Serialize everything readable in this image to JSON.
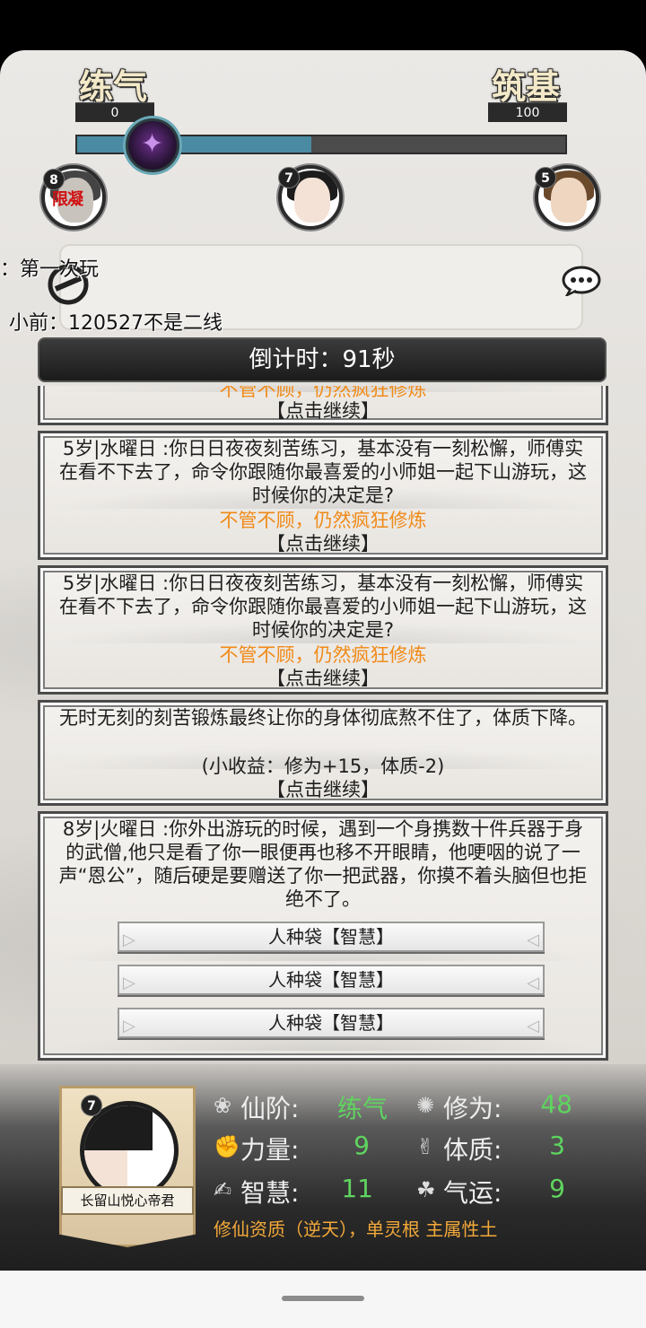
{
  "realm": {
    "current": {
      "name": "练气",
      "value": "0"
    },
    "next": {
      "name": "筑基",
      "value": "100"
    },
    "progress": 0.48
  },
  "opponents": [
    {
      "badge": "8",
      "tag": "限凝"
    },
    {
      "badge": "7",
      "tag": ""
    },
    {
      "badge": "5",
      "tag": ""
    }
  ],
  "chat": {
    "line1": "：第一次玩",
    "line2": "小前：120527不是二线"
  },
  "timer": {
    "text": "倒计时：91秒"
  },
  "feed": {
    "top_choice": "不管不顾，仍然疯狂修炼",
    "top_continue": "【点击继续】",
    "cards": [
      {
        "text": "5岁|水曜日 :你日日夜夜刻苦练习，基本没有一刻松懈，师傅实在看不下去了，命令你跟随你最喜爱的小师姐一起下山游玩，这时候你的决定是?",
        "choice": "不管不顾，仍然疯狂修炼",
        "continue": "【点击继续】"
      },
      {
        "text": "5岁|水曜日 :你日日夜夜刻苦练习，基本没有一刻松懈，师傅实在看不下去了，命令你跟随你最喜爱的小师姐一起下山游玩，这时候你的决定是?",
        "choice": "不管不顾，仍然疯狂修炼",
        "continue": "【点击继续】"
      },
      {
        "text": "无时无刻的刻苦锻炼最终让你的身体彻底熬不住了，体质下降。",
        "gain": "(小收益：修为+15，体质-2)",
        "continue": "【点击继续】"
      }
    ],
    "event": {
      "text": "8岁|火曜日 :你外出游玩的时候，遇到一个身携数十件兵器于身的武僧,他只是看了你一眼便再也移不开眼睛，他哽咽的说了一声“恩公”，随后硬是要赠送了你一把武器，你摸不着头脑但也拒绝不了。",
      "options": [
        "人种袋【智慧】",
        "人种袋【智慧】",
        "人种袋【智慧】"
      ]
    }
  },
  "player": {
    "badge": "7",
    "name": "长留山悦心帝君",
    "stats": {
      "realm_label": "仙阶:",
      "realm_value": "练气",
      "cultivation_label": "修为:",
      "cultivation_value": "48",
      "strength_label": "力量:",
      "strength_value": "9",
      "constitution_label": "体质:",
      "constitution_value": "3",
      "wisdom_label": "智慧:",
      "wisdom_value": "11",
      "luck_label": "气运:",
      "luck_value": "9"
    },
    "talent": "修仙资质（逆天），单灵根 主属性土"
  },
  "colors": {
    "choice": "#f08a18",
    "stat_value": "#5fd45f",
    "talent": "#f3a93a",
    "xp_fill": "#4a8aa3"
  }
}
